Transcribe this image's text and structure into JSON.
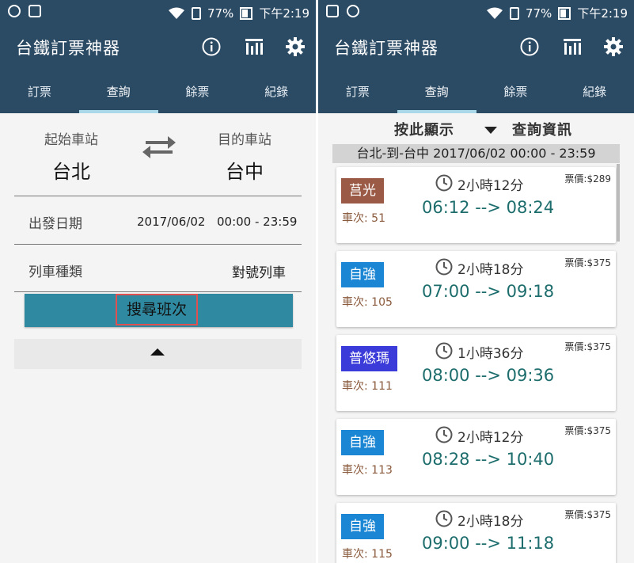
{
  "colors": {
    "app_bar": "#2b4a64",
    "tab_indicator": "#a9d9e8",
    "search_button": "#2f8aa1",
    "time_text": "#1d6d6d",
    "badge_ziguang": "#9b5a46",
    "badge_ziqiang": "#1b86d4",
    "badge_puyuma": "#3b3bd9"
  },
  "status_bar": {
    "battery": "77%",
    "time": "下午2:19"
  },
  "app": {
    "title": "台鐵訂票神器",
    "icons": [
      "info-icon",
      "stats-icon",
      "gear-icon"
    ]
  },
  "tabs": [
    "訂票",
    "查詢",
    "餘票",
    "紀錄"
  ],
  "active_tab": "查詢",
  "query": {
    "from_label": "起始車站",
    "from_station": "台北",
    "to_label": "目的車站",
    "to_station": "台中",
    "date_label": "出發日期",
    "date_value": "2017/06/02",
    "time_range": "00:00 - 23:59",
    "train_type_label": "列車種類",
    "train_type_value": "對號列車",
    "search_button": "搜尋班次"
  },
  "results": {
    "sort_label": "按此顯示",
    "info_label": "查詢資訊",
    "route_summary": "台北-到-台中 2017/06/02 00:00 - 23:59",
    "trains": [
      {
        "type": "莒光",
        "badge_color": "#9b5a46",
        "train_no": "車次: 51",
        "duration": "2小時12分",
        "price": "票價:$289",
        "times": "06:12 --> 08:24"
      },
      {
        "type": "自強",
        "badge_color": "#1b86d4",
        "train_no": "車次: 105",
        "duration": "2小時18分",
        "price": "票價:$375",
        "times": "07:00 --> 09:18"
      },
      {
        "type": "普悠瑪",
        "badge_color": "#3b3bd9",
        "train_no": "車次: 111",
        "duration": "1小時36分",
        "price": "票價:$375",
        "times": "08:00 --> 09:36"
      },
      {
        "type": "自強",
        "badge_color": "#1b86d4",
        "train_no": "車次: 113",
        "duration": "2小時12分",
        "price": "票價:$375",
        "times": "08:28 --> 10:40"
      },
      {
        "type": "自強",
        "badge_color": "#1b86d4",
        "train_no": "車次: 115",
        "duration": "2小時18分",
        "price": "票價:$375",
        "times": "09:00 --> 11:18"
      }
    ]
  }
}
